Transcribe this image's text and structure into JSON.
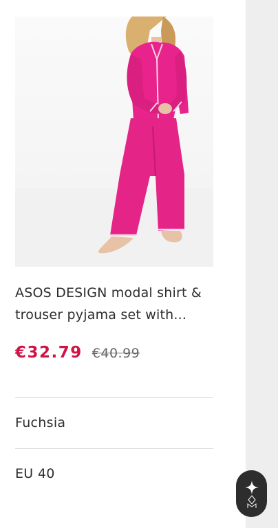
{
  "product": {
    "title": "ASOS DESIGN modal shirt & trouser pyjama set with...",
    "price_sale": "€32.79",
    "price_original": "€40.99",
    "image_alt": "Model wearing fuchsia pyjama shirt and trousers",
    "colors": {
      "sale": "#d01345",
      "text": "#2d2d2d",
      "garment": "#e8238b"
    }
  },
  "attributes": {
    "color": "Fuchsia",
    "size": "EU 40"
  },
  "assistant_button": {
    "icon": "sparkle-logo-icon"
  }
}
